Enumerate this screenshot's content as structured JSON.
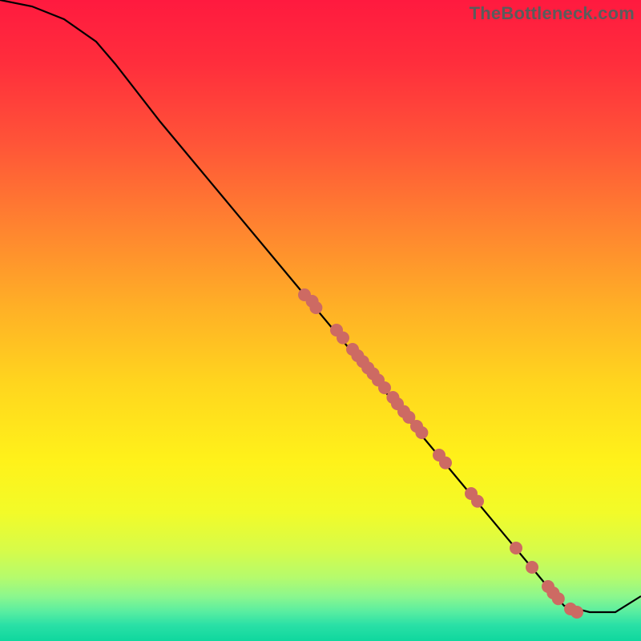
{
  "watermark": "TheBottleneck.com",
  "chart_data": {
    "type": "line",
    "title": "",
    "xlabel": "",
    "ylabel": "",
    "xlim": [
      0,
      100
    ],
    "ylim": [
      0,
      100
    ],
    "grid": false,
    "legend": false,
    "series": [
      {
        "name": "curve",
        "x": [
          0,
          5,
          10,
          15,
          18,
          25,
          35,
          45,
          55,
          65,
          75,
          85,
          88,
          92,
          96,
          100
        ],
        "y": [
          100,
          99,
          97,
          93.5,
          90,
          81,
          69,
          57,
          45,
          33,
          21,
          9,
          5.5,
          4.5,
          4.5,
          7
        ]
      }
    ],
    "points": [
      {
        "x": 47.5,
        "y": 54
      },
      {
        "x": 48.7,
        "y": 53
      },
      {
        "x": 49.3,
        "y": 52
      },
      {
        "x": 52.5,
        "y": 48.5
      },
      {
        "x": 53.5,
        "y": 47.3
      },
      {
        "x": 55.0,
        "y": 45.5
      },
      {
        "x": 55.8,
        "y": 44.5
      },
      {
        "x": 56.6,
        "y": 43.6
      },
      {
        "x": 57.4,
        "y": 42.6
      },
      {
        "x": 58.2,
        "y": 41.7
      },
      {
        "x": 59.0,
        "y": 40.7
      },
      {
        "x": 60.0,
        "y": 39.5
      },
      {
        "x": 61.3,
        "y": 38.0
      },
      {
        "x": 62.0,
        "y": 37.0
      },
      {
        "x": 63.0,
        "y": 35.8
      },
      {
        "x": 63.8,
        "y": 34.9
      },
      {
        "x": 65.0,
        "y": 33.5
      },
      {
        "x": 65.8,
        "y": 32.5
      },
      {
        "x": 68.5,
        "y": 29
      },
      {
        "x": 69.5,
        "y": 27.8
      },
      {
        "x": 73.5,
        "y": 23
      },
      {
        "x": 74.5,
        "y": 21.8
      },
      {
        "x": 80.5,
        "y": 14.5
      },
      {
        "x": 83.0,
        "y": 11.5
      },
      {
        "x": 85.5,
        "y": 8.5
      },
      {
        "x": 86.3,
        "y": 7.5
      },
      {
        "x": 87.1,
        "y": 6.6
      },
      {
        "x": 89.0,
        "y": 5.0
      },
      {
        "x": 90.0,
        "y": 4.5
      }
    ],
    "gradient_stops": [
      {
        "offset": 0.0,
        "color": "#ff1a3f"
      },
      {
        "offset": 0.1,
        "color": "#ff2e3c"
      },
      {
        "offset": 0.22,
        "color": "#ff5338"
      },
      {
        "offset": 0.35,
        "color": "#ff8230"
      },
      {
        "offset": 0.48,
        "color": "#ffb026"
      },
      {
        "offset": 0.6,
        "color": "#ffd61e"
      },
      {
        "offset": 0.72,
        "color": "#fff21a"
      },
      {
        "offset": 0.8,
        "color": "#f2fb29"
      },
      {
        "offset": 0.86,
        "color": "#d6fb4a"
      },
      {
        "offset": 0.9,
        "color": "#b6fb6c"
      },
      {
        "offset": 0.93,
        "color": "#8cf78d"
      },
      {
        "offset": 0.955,
        "color": "#57eda1"
      },
      {
        "offset": 0.975,
        "color": "#2ae0a6"
      },
      {
        "offset": 1.0,
        "color": "#0fd79e"
      }
    ],
    "point_color": "#cd6a63",
    "line_color": "#000000"
  }
}
